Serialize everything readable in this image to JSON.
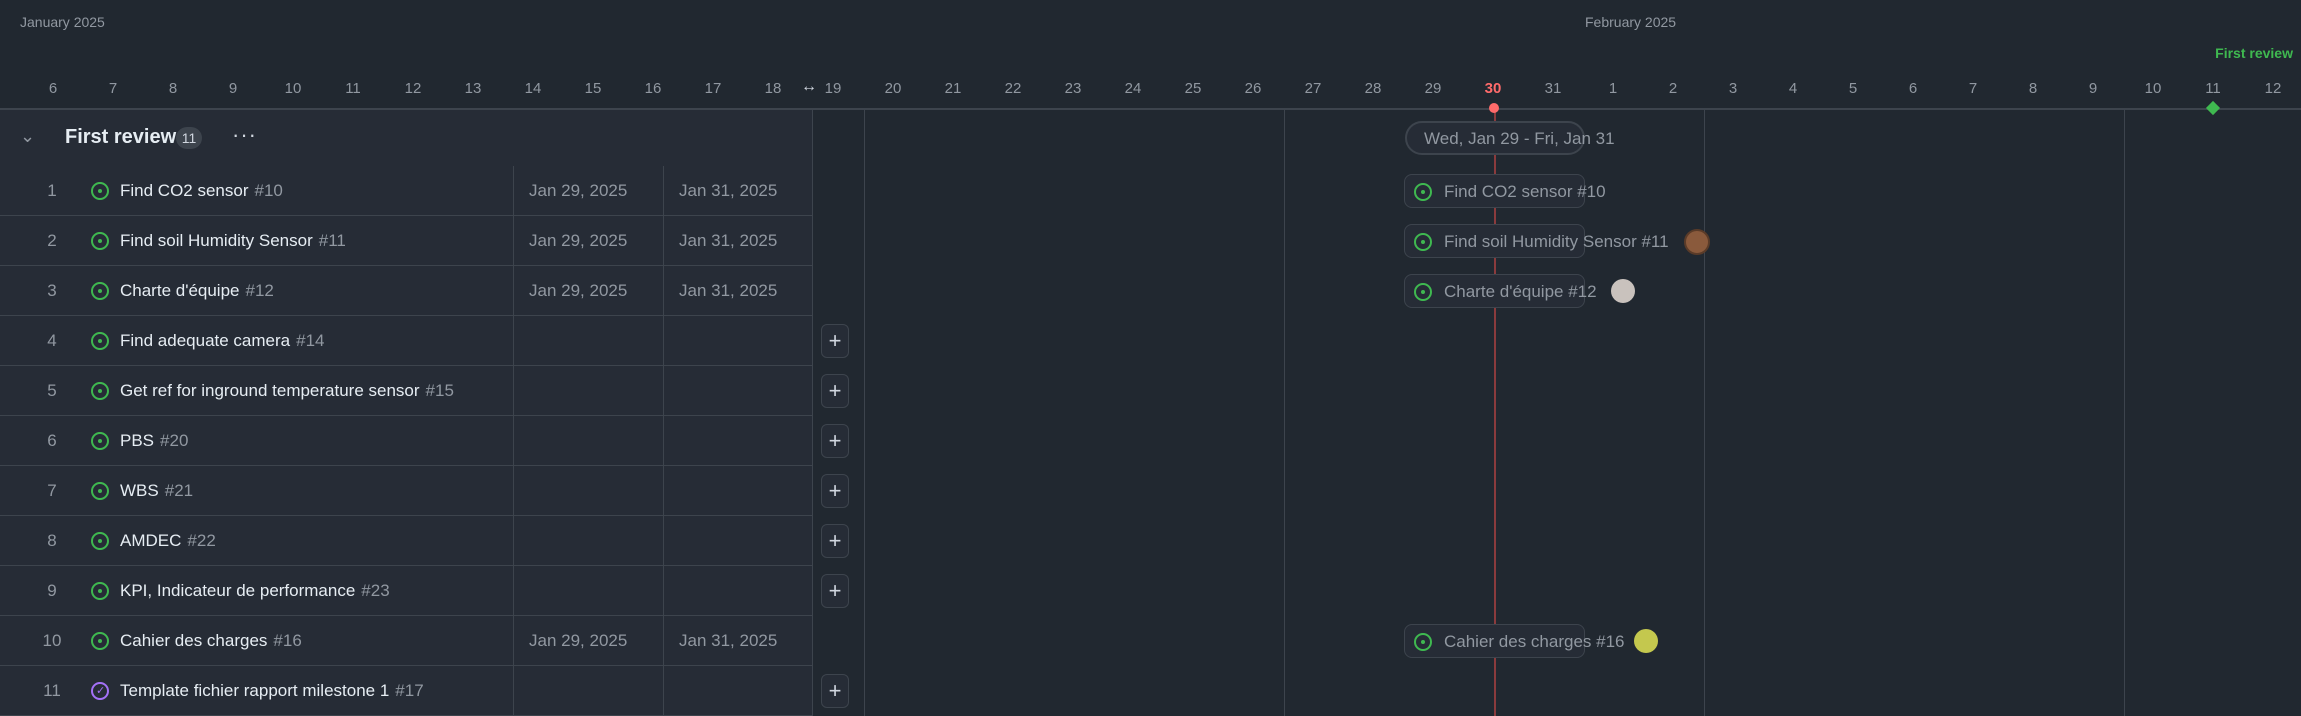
{
  "timeline": {
    "months": [
      {
        "label": "January 2025"
      },
      {
        "label": "February 2025"
      }
    ],
    "days": [
      "6",
      "7",
      "8",
      "9",
      "10",
      "11",
      "12",
      "13",
      "14",
      "15",
      "16",
      "17",
      "18",
      "19",
      "20",
      "21",
      "22",
      "23",
      "24",
      "25",
      "26",
      "27",
      "28",
      "29",
      "30",
      "31",
      "1",
      "2",
      "3",
      "4",
      "5",
      "6",
      "7",
      "8",
      "9",
      "10",
      "11",
      "12"
    ],
    "today_label": "30",
    "milestone_label": "First review"
  },
  "group": {
    "title": "First review",
    "count": "11",
    "more_label": "···"
  },
  "rows": [
    {
      "num": "1",
      "title": "Find CO2 sensor",
      "number": "#10",
      "start": "Jan 29, 2025",
      "end": "Jan 31, 2025",
      "status": "open"
    },
    {
      "num": "2",
      "title": "Find soil Humidity Sensor",
      "number": "#11",
      "start": "Jan 29, 2025",
      "end": "Jan 31, 2025",
      "status": "open"
    },
    {
      "num": "3",
      "title": "Charte d'équipe",
      "number": "#12",
      "start": "Jan 29, 2025",
      "end": "Jan 31, 2025",
      "status": "open"
    },
    {
      "num": "4",
      "title": "Find adequate camera",
      "number": "#14",
      "start": "",
      "end": "",
      "status": "open"
    },
    {
      "num": "5",
      "title": "Get ref for inground temperature sensor",
      "number": "#15",
      "start": "",
      "end": "",
      "status": "open"
    },
    {
      "num": "6",
      "title": "PBS",
      "number": "#20",
      "start": "",
      "end": "",
      "status": "open"
    },
    {
      "num": "7",
      "title": "WBS",
      "number": "#21",
      "start": "",
      "end": "",
      "status": "open"
    },
    {
      "num": "8",
      "title": "AMDEC",
      "number": "#22",
      "start": "",
      "end": "",
      "status": "open"
    },
    {
      "num": "9",
      "title": "KPI, Indicateur de performance",
      "number": "#23",
      "start": "",
      "end": "",
      "status": "open"
    },
    {
      "num": "10",
      "title": "Cahier des charges",
      "number": "#16",
      "start": "Jan 29, 2025",
      "end": "Jan 31, 2025",
      "status": "open"
    },
    {
      "num": "11",
      "title": "Template fichier rapport milestone 1",
      "number": "#17",
      "start": "",
      "end": "",
      "status": "done"
    }
  ],
  "gantt": {
    "range_label": "Wed, Jan 29 - Fri, Jan 31",
    "bars": [
      {
        "label": "Find CO2 sensor #10"
      },
      {
        "label": "Find soil Humidity Sensor #11"
      },
      {
        "label": "Charte d'équipe #12"
      },
      {
        "label": "Cahier des charges #16"
      }
    ]
  },
  "add_label": "+",
  "colors": {
    "background": "#212830",
    "accent_green": "#3fb950",
    "today_red": "#ff6b6b",
    "done_purple": "#a371f7"
  }
}
